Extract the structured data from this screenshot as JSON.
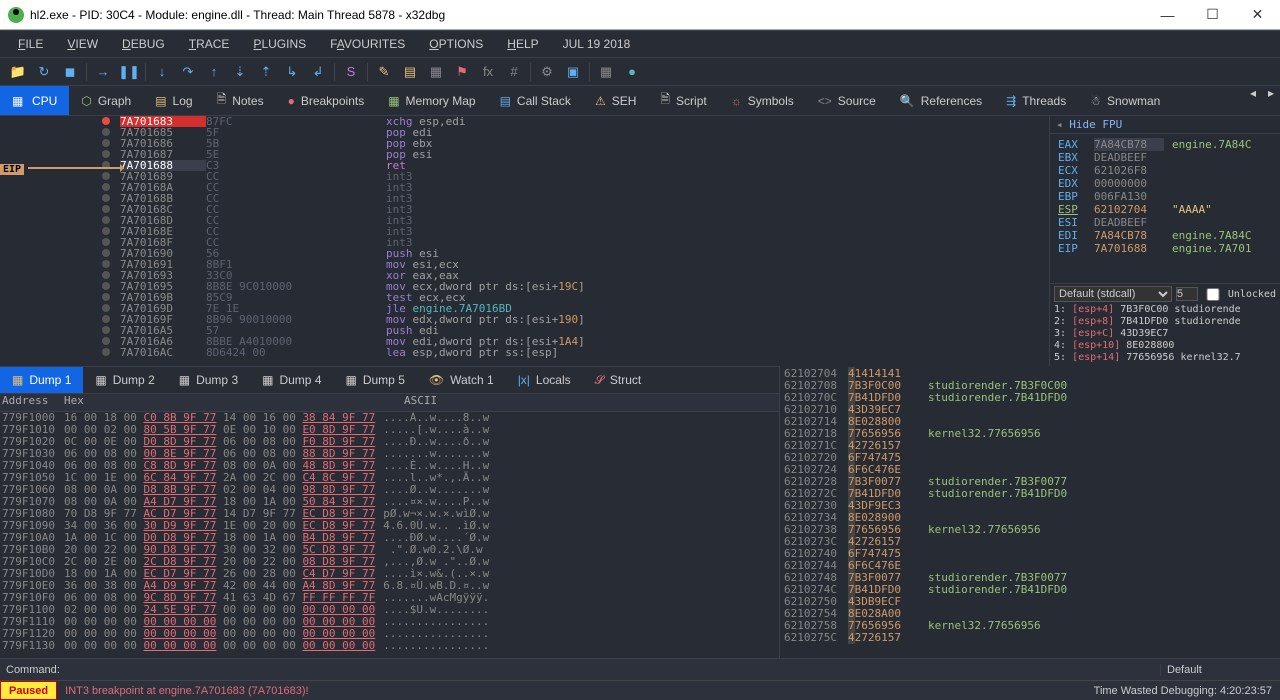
{
  "window": {
    "title": "hl2.exe - PID: 30C4 - Module: engine.dll - Thread: Main Thread 5878 - x32dbg"
  },
  "menubar": [
    "FILE",
    "VIEW",
    "DEBUG",
    "TRACE",
    "PLUGINS",
    "FAVOURITES",
    "OPTIONS",
    "HELP",
    "JUL 19 2018"
  ],
  "view_tabs": [
    "CPU",
    "Graph",
    "Log",
    "Notes",
    "Breakpoints",
    "Memory Map",
    "Call Stack",
    "SEH",
    "Script",
    "Symbols",
    "Source",
    "References",
    "Threads",
    "Snowman"
  ],
  "disasm": [
    {
      "addr": "7A701683",
      "bytes": "87FC",
      "instr": "xchg esp,edi",
      "bp": true
    },
    {
      "addr": "7A701685",
      "bytes": "5F",
      "instr": "pop edi"
    },
    {
      "addr": "7A701686",
      "bytes": "5B",
      "instr": "pop ebx"
    },
    {
      "addr": "7A701687",
      "bytes": "5E",
      "instr": "pop esi"
    },
    {
      "addr": "7A701688",
      "bytes": "C3",
      "instr": "ret",
      "eip": true
    },
    {
      "addr": "7A701689",
      "bytes": "CC",
      "instr": "int3"
    },
    {
      "addr": "7A70168A",
      "bytes": "CC",
      "instr": "int3"
    },
    {
      "addr": "7A70168B",
      "bytes": "CC",
      "instr": "int3"
    },
    {
      "addr": "7A70168C",
      "bytes": "CC",
      "instr": "int3"
    },
    {
      "addr": "7A70168D",
      "bytes": "CC",
      "instr": "int3"
    },
    {
      "addr": "7A70168E",
      "bytes": "CC",
      "instr": "int3"
    },
    {
      "addr": "7A70168F",
      "bytes": "CC",
      "instr": "int3"
    },
    {
      "addr": "7A701690",
      "bytes": "56",
      "instr": "push esi"
    },
    {
      "addr": "7A701691",
      "bytes": "8BF1",
      "instr": "mov esi,ecx"
    },
    {
      "addr": "7A701693",
      "bytes": "33C0",
      "instr": "xor eax,eax"
    },
    {
      "addr": "7A701695",
      "bytes": "8B8E 9C010000",
      "instr": "mov ecx,dword ptr ds:[esi+19C]"
    },
    {
      "addr": "7A70169B",
      "bytes": "85C9",
      "instr": "test ecx,ecx"
    },
    {
      "addr": "7A70169D",
      "bytes": "7E 1E",
      "instr": "jle engine.7A7016BD"
    },
    {
      "addr": "7A70169F",
      "bytes": "8B96 90010000",
      "instr": "mov edx,dword ptr ds:[esi+190]"
    },
    {
      "addr": "7A7016A5",
      "bytes": "57",
      "instr": "push edi"
    },
    {
      "addr": "7A7016A6",
      "bytes": "8BBE A4010000",
      "instr": "mov edi,dword ptr ds:[esi+1A4]"
    },
    {
      "addr": "7A7016AC",
      "bytes": "8D6424 00",
      "instr": "lea esp,dword ptr ss:[esp]"
    }
  ],
  "registers": {
    "title": "Hide FPU",
    "rows": [
      {
        "name": "EAX",
        "val": "7A84CB78",
        "extra": "engine.7A84C"
      },
      {
        "name": "EBX",
        "val": "DEADBEEF",
        "extra": ""
      },
      {
        "name": "ECX",
        "val": "621026F8",
        "extra": ""
      },
      {
        "name": "EDX",
        "val": "00000000",
        "extra": ""
      },
      {
        "name": "EBP",
        "val": "006FA130",
        "extra": ""
      },
      {
        "name": "ESP",
        "val": "62102704",
        "extra": "\"AAAA\""
      },
      {
        "name": "ESI",
        "val": "DEADBEEF",
        "extra": ""
      },
      {
        "name": "EDI",
        "val": "7A84CB78",
        "extra": "engine.7A84C"
      },
      {
        "name": "",
        "val": "",
        "extra": ""
      },
      {
        "name": "EIP",
        "val": "7A701688",
        "extra": "engine.7A701"
      }
    ]
  },
  "callframe": {
    "dropdown": "Default (stdcall)",
    "count": "5",
    "unlocked": "Unlocked",
    "rows": [
      "1: [esp+4] 7B3F0C00 studiorende",
      "2: [esp+8] 7B41DFD0 studiorende",
      "3: [esp+C] 43D39EC7",
      "4: [esp+10] 8E028800",
      "5: [esp+14] 77656956 kernel32.7"
    ]
  },
  "dump_tabs": [
    "Dump 1",
    "Dump 2",
    "Dump 3",
    "Dump 4",
    "Dump 5",
    "Watch 1",
    "Locals",
    "Struct"
  ],
  "dump_header": {
    "addr": "Address",
    "hex": "Hex",
    "ascii": "ASCII"
  },
  "dump_rows": [
    {
      "a": "779F1000",
      "h": [
        "16 00 18 00",
        "C0 8B 9F 77",
        "14 00 16 00",
        "38 84 9F 77"
      ],
      "s": "....À..w....8..w"
    },
    {
      "a": "779F1010",
      "h": [
        "00 00 02 00",
        "80 5B 9F 77",
        "0E 00 10 00",
        "E0 8D 9F 77"
      ],
      "s": ".....[.w....à..w"
    },
    {
      "a": "779F1020",
      "h": [
        "0C 00 0E 00",
        "D0 8D 9F 77",
        "06 00 08 00",
        "F0 8D 9F 77"
      ],
      "s": "....Ð..w....ð..w"
    },
    {
      "a": "779F1030",
      "h": [
        "06 00 08 00",
        "00 8E 9F 77",
        "06 00 08 00",
        "88 8D 9F 77"
      ],
      "s": ".......w.......w"
    },
    {
      "a": "779F1040",
      "h": [
        "06 00 08 00",
        "C8 8D 9F 77",
        "08 00 0A 00",
        "48 8D 9F 77"
      ],
      "s": "....È..w....H..w"
    },
    {
      "a": "779F1050",
      "h": [
        "1C 00 1E 00",
        "6C 84 9F 77",
        "2A 00 2C 00",
        "C4 8C 9F 77"
      ],
      "s": "....l..w*.,.Ä..w"
    },
    {
      "a": "779F1060",
      "h": [
        "08 00 0A 00",
        "D8 8B 9F 77",
        "02 00 04 00",
        "98 8D 9F 77"
      ],
      "s": "....Ø..w.......w"
    },
    {
      "a": "779F1070",
      "h": [
        "08 00 0A 00",
        "A4 D7 9F 77",
        "18 00 1A 00",
        "50 84 9F 77"
      ],
      "s": "....¤×.w....P..w"
    },
    {
      "a": "779F1080",
      "h": [
        "70 D8 9F 77",
        "AC D7 9F 77",
        "14 D7 9F 77",
        "EC D8 9F 77"
      ],
      "s": "pØ.w¬×.w.×.wìØ.w"
    },
    {
      "a": "779F1090",
      "h": [
        "34 00 36 00",
        "30 D9 9F 77",
        "1E 00 20 00",
        "EC D8 9F 77"
      ],
      "s": "4.6.0Ù.w.. .ìØ.w"
    },
    {
      "a": "779F10A0",
      "h": [
        "1A 00 1C 00",
        "D0 D8 9F 77",
        "18 00 1A 00",
        "B4 D8 9F 77"
      ],
      "s": "....ÐØ.w....´Ø.w"
    },
    {
      "a": "779F10B0",
      "h": [
        "20 00 22 00",
        "90 D8 9F 77",
        "30 00 32 00",
        "5C D8 9F 77"
      ],
      "s": " .\".Ø.w0.2.\\Ø.w"
    },
    {
      "a": "779F10C0",
      "h": [
        "2C 00 2E 00",
        "2C D8 9F 77",
        "20 00 22 00",
        "08 D8 9F 77"
      ],
      "s": ",...,Ø.w .\"..Ø.w"
    },
    {
      "a": "779F10D0",
      "h": [
        "18 00 1A 00",
        "EC D7 9F 77",
        "26 00 28 00",
        "C4 D7 9F 77"
      ],
      "s": "....ì×.w&.(..×.w"
    },
    {
      "a": "779F10E0",
      "h": [
        "36 00 38 00",
        "A4 D9 9F 77",
        "42 00 44 00",
        "A4 8D 9F 77"
      ],
      "s": "6.8.¤Ù.wB.D.¤..w"
    },
    {
      "a": "779F10F0",
      "h": [
        "06 00 08 00",
        "9C 8D 9F 77",
        "41 63 4D 67",
        "FF FF FF 7F"
      ],
      "s": ".......wAcMgÿÿÿ."
    },
    {
      "a": "779F1100",
      "h": [
        "02 00 00 00",
        "24 5E 9F 77",
        "00 00 00 00",
        "00 00 00 00"
      ],
      "s": "....$U.w........"
    },
    {
      "a": "779F1110",
      "h": [
        "00 00 00 00",
        "00 00 00 00",
        "00 00 00 00",
        "00 00 00 00"
      ],
      "s": "................"
    },
    {
      "a": "779F1120",
      "h": [
        "00 00 00 00",
        "00 00 00 00",
        "00 00 00 00",
        "00 00 00 00"
      ],
      "s": "................"
    },
    {
      "a": "779F1130",
      "h": [
        "00 00 00 00",
        "00 00 00 00",
        "00 00 00 00",
        "00 00 00 00"
      ],
      "s": "................"
    }
  ],
  "stack_rows": [
    {
      "a": "62102704",
      "v": "41414141",
      "d": ""
    },
    {
      "a": "62102708",
      "v": "7B3F0C00",
      "d": "studiorender.7B3F0C00"
    },
    {
      "a": "6210270C",
      "v": "7B41DFD0",
      "d": "studiorender.7B41DFD0"
    },
    {
      "a": "62102710",
      "v": "43D39EC7",
      "d": ""
    },
    {
      "a": "62102714",
      "v": "8E028800",
      "d": ""
    },
    {
      "a": "62102718",
      "v": "77656956",
      "d": "kernel32.77656956"
    },
    {
      "a": "6210271C",
      "v": "42726157",
      "d": ""
    },
    {
      "a": "62102720",
      "v": "6F747475",
      "d": ""
    },
    {
      "a": "62102724",
      "v": "6F6C476E",
      "d": ""
    },
    {
      "a": "62102728",
      "v": "7B3F0077",
      "d": "studiorender.7B3F0077"
    },
    {
      "a": "6210272C",
      "v": "7B41DFD0",
      "d": "studiorender.7B41DFD0"
    },
    {
      "a": "62102730",
      "v": "43DF9EC3",
      "d": ""
    },
    {
      "a": "62102734",
      "v": "8E028900",
      "d": ""
    },
    {
      "a": "62102738",
      "v": "77656956",
      "d": "kernel32.77656956"
    },
    {
      "a": "6210273C",
      "v": "42726157",
      "d": ""
    },
    {
      "a": "62102740",
      "v": "6F747475",
      "d": ""
    },
    {
      "a": "62102744",
      "v": "6F6C476E",
      "d": ""
    },
    {
      "a": "62102748",
      "v": "7B3F0077",
      "d": "studiorender.7B3F0077"
    },
    {
      "a": "6210274C",
      "v": "7B41DFD0",
      "d": "studiorender.7B41DFD0"
    },
    {
      "a": "62102750",
      "v": "43DB9ECF",
      "d": ""
    },
    {
      "a": "62102754",
      "v": "8E028A00",
      "d": ""
    },
    {
      "a": "62102758",
      "v": "77656956",
      "d": "kernel32.77656956"
    },
    {
      "a": "6210275C",
      "v": "42726157",
      "d": ""
    }
  ],
  "command": {
    "label": "Command:",
    "mode": "Default"
  },
  "status": {
    "paused": "Paused",
    "msg": "INT3 breakpoint at engine.7A701683 (7A701683)!",
    "time": "Time Wasted Debugging: 4:20:23:57"
  }
}
